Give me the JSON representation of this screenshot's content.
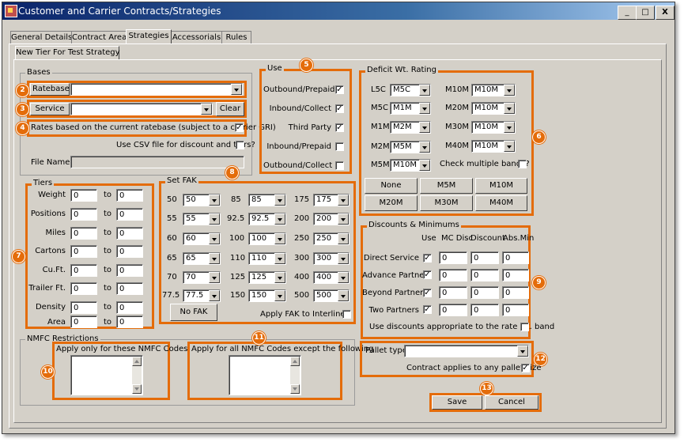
{
  "window": {
    "title": "Customer and Carrier Contracts/Strategies",
    "minimize": "_",
    "maximize": "□",
    "close": "X"
  },
  "tabs": [
    "General Details",
    "Contract Areas",
    "Strategies",
    "Accessorials",
    "Rules"
  ],
  "subtab": "New Tier For Test Strategy",
  "callouts": [
    "2",
    "3",
    "4",
    "5",
    "6",
    "7",
    "8",
    "9",
    "10",
    "11",
    "12",
    "13"
  ],
  "bases": {
    "title": "Bases",
    "ratebase_label": "Ratebase",
    "ratebase_value": "",
    "service_label": "Service",
    "service_value": "",
    "clear_label": "Clear",
    "rates_label": "Rates based on the current ratebase (subject to a carrier GRI)",
    "rates_checked": true,
    "csv_label": "Use CSV file for discount and tiers?",
    "csv_checked": false,
    "filename_label": "File Name",
    "filename_value": ""
  },
  "use": {
    "title": "Use",
    "items": [
      {
        "label": "Outbound/Prepaid",
        "checked": true
      },
      {
        "label": "Inbound/Collect",
        "checked": true
      },
      {
        "label": "Third Party",
        "checked": true
      },
      {
        "label": "Inbound/Prepaid",
        "checked": false
      },
      {
        "label": "Outbound/Collect",
        "checked": false
      }
    ]
  },
  "deficit": {
    "title": "Deficit Wt. Rating",
    "left": [
      {
        "label": "L5C",
        "value": "M5C"
      },
      {
        "label": "M5C",
        "value": "M1M"
      },
      {
        "label": "M1M",
        "value": "M2M"
      },
      {
        "label": "M2M",
        "value": "M5M"
      },
      {
        "label": "M5M",
        "value": "M10M"
      }
    ],
    "right": [
      {
        "label": "M10M",
        "value": "M10M"
      },
      {
        "label": "M20M",
        "value": "M10M"
      },
      {
        "label": "M30M",
        "value": "M10M"
      },
      {
        "label": "M40M",
        "value": "M10M"
      }
    ],
    "check_multiple_label": "Check multiple bands?",
    "check_multiple_checked": false,
    "buttons": [
      "None",
      "M5M",
      "M10M",
      "M20M",
      "M30M",
      "M40M"
    ]
  },
  "tiers": {
    "title": "Tiers",
    "to_label": "to",
    "rows": [
      {
        "label": "Weight",
        "from": "0",
        "to": "0"
      },
      {
        "label": "Positions",
        "from": "0",
        "to": "0"
      },
      {
        "label": "Miles",
        "from": "0",
        "to": "0"
      },
      {
        "label": "Cartons",
        "from": "0",
        "to": "0"
      },
      {
        "label": "Cu.Ft.",
        "from": "0",
        "to": "0"
      },
      {
        "label": "Trailer Ft.",
        "from": "0",
        "to": "0"
      },
      {
        "label": "Density",
        "from": "0",
        "to": "0"
      },
      {
        "label": "Area",
        "from": "0",
        "to": "0"
      }
    ]
  },
  "fak": {
    "title": "Set FAK",
    "rows": [
      [
        {
          "label": "50",
          "value": "50"
        },
        {
          "label": "85",
          "value": "85"
        },
        {
          "label": "175",
          "value": "175"
        }
      ],
      [
        {
          "label": "55",
          "value": "55"
        },
        {
          "label": "92.5",
          "value": "92.5"
        },
        {
          "label": "200",
          "value": "200"
        }
      ],
      [
        {
          "label": "60",
          "value": "60"
        },
        {
          "label": "100",
          "value": "100"
        },
        {
          "label": "250",
          "value": "250"
        }
      ],
      [
        {
          "label": "65",
          "value": "65"
        },
        {
          "label": "110",
          "value": "110"
        },
        {
          "label": "300",
          "value": "300"
        }
      ],
      [
        {
          "label": "70",
          "value": "70"
        },
        {
          "label": "125",
          "value": "125"
        },
        {
          "label": "400",
          "value": "400"
        }
      ],
      [
        {
          "label": "77.5",
          "value": "77.5"
        },
        {
          "label": "150",
          "value": "150"
        },
        {
          "label": "500",
          "value": "500"
        }
      ]
    ],
    "nofak_label": "No FAK",
    "interline_label": "Apply FAK to Interline?",
    "interline_checked": false
  },
  "discounts": {
    "title": "Discounts & Minimums",
    "headers": [
      "Use",
      "MC Disc",
      "Discount",
      "Abs.Min"
    ],
    "rows": [
      {
        "label": "Direct Service",
        "checked": true,
        "mc": "0",
        "disc": "0",
        "abs": "0"
      },
      {
        "label": "Advance Partner",
        "checked": true,
        "mc": "0",
        "disc": "0",
        "abs": "0"
      },
      {
        "label": "Beyond Partner",
        "checked": true,
        "mc": "0",
        "disc": "0",
        "abs": "0"
      },
      {
        "label": "Two Partners",
        "checked": true,
        "mc": "0",
        "disc": "0",
        "abs": "0"
      }
    ],
    "rate_band_label": "Use discounts appropriate to the rate wt. band",
    "rate_band_checked": false
  },
  "nmfc": {
    "title": "NMFC Restrictions",
    "only_label": "Apply only for these NMFC Codes",
    "except_label": "Apply for all NMFC Codes except the following"
  },
  "pallet": {
    "label": "Pallet type",
    "value": "",
    "any_label": "Contract applies to any pallet size",
    "any_checked": true
  },
  "actions": {
    "save": "Save",
    "cancel": "Cancel"
  },
  "check_mark": "✓"
}
